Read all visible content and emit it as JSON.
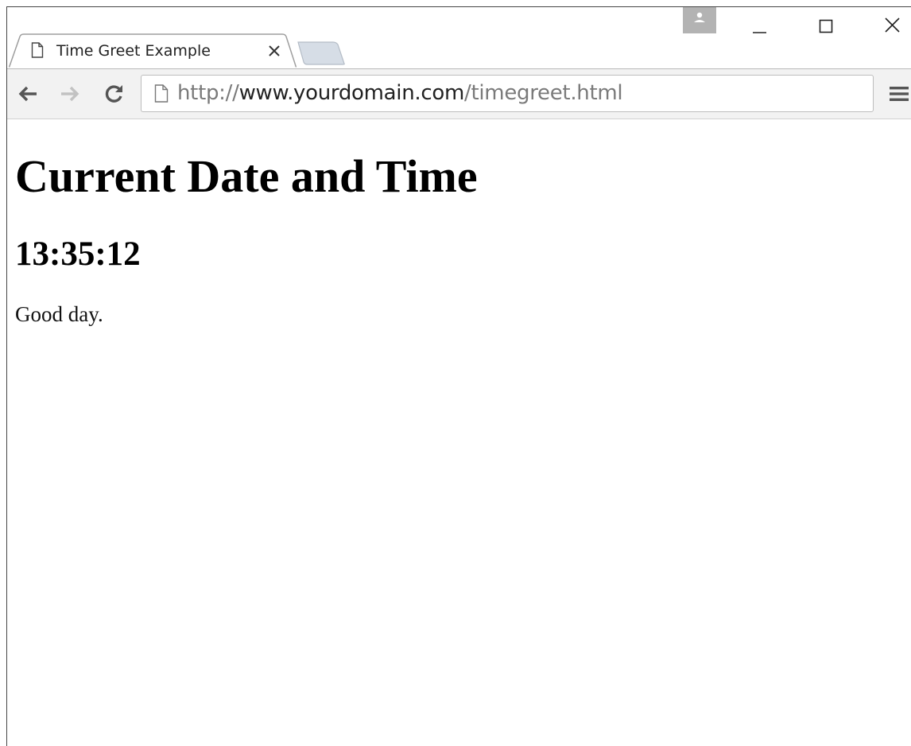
{
  "browser": {
    "tab": {
      "title": "Time Greet Example",
      "page_icon": "page-icon",
      "close_icon": "close-icon"
    },
    "new_tab_icon": "new-tab-icon",
    "profile_icon": "person-icon",
    "window_controls": {
      "minimize_icon": "minimize-icon",
      "maximize_icon": "maximize-icon",
      "close_icon": "close-icon"
    },
    "toolbar": {
      "back_icon": "arrow-left-icon",
      "forward_icon": "arrow-right-icon",
      "reload_icon": "reload-icon",
      "menu_icon": "hamburger-menu-icon"
    },
    "address_bar": {
      "page_icon": "page-icon",
      "url_scheme": "http://",
      "url_host": "www.yourdomain.com",
      "url_path": "/timegreet.html"
    }
  },
  "page": {
    "heading": "Current Date and Time",
    "time": "13:35:12",
    "greeting": "Good day."
  },
  "colors": {
    "toolbar_bg": "#f2f2f2",
    "profile_bg": "#b3b3b3",
    "url_dim": "#7a7a7a",
    "url_host": "#222222"
  }
}
